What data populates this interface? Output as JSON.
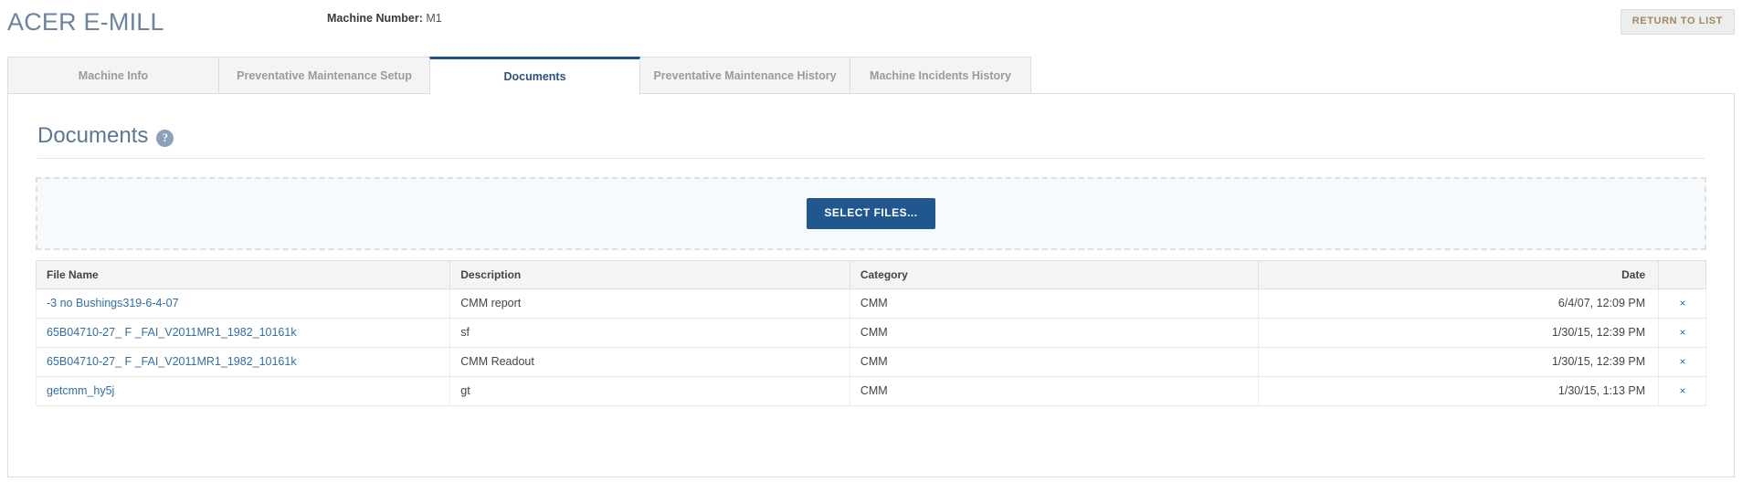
{
  "header": {
    "brand": "ACER E-MILL",
    "machine_number_label": "Machine Number:",
    "machine_number_value": "M1",
    "return_button": "RETURN TO LIST"
  },
  "tabs": [
    {
      "label": "Machine Info",
      "active": false
    },
    {
      "label": "Preventative Maintenance Setup",
      "active": false
    },
    {
      "label": "Documents",
      "active": true
    },
    {
      "label": "Preventative Maintenance History",
      "active": false
    },
    {
      "label": "Machine Incidents History",
      "active": false
    }
  ],
  "section": {
    "title": "Documents",
    "help_icon": "help-icon",
    "help_glyph": "?"
  },
  "dropzone": {
    "select_files_label": "SELECT FILES..."
  },
  "table": {
    "columns": [
      "File Name",
      "Description",
      "Category",
      "Date",
      ""
    ],
    "rows": [
      {
        "file_name": "-3 no Bushings319-6-4-07",
        "description": "CMM report",
        "category": "CMM",
        "date": "6/4/07, 12:09 PM",
        "remove": "×"
      },
      {
        "file_name": "65B04710-27_ F _FAI_V2011MR1_1982_10161k",
        "description": "sf",
        "category": "CMM",
        "date": "1/30/15, 12:39 PM",
        "remove": "×"
      },
      {
        "file_name": "65B04710-27_ F _FAI_V2011MR1_1982_10161k",
        "description": "CMM Readout",
        "category": "CMM",
        "date": "1/30/15, 12:39 PM",
        "remove": "×"
      },
      {
        "file_name": "getcmm_hy5j",
        "description": "gt",
        "category": "CMM",
        "date": "1/30/15, 1:13 PM",
        "remove": "×"
      }
    ]
  },
  "colors": {
    "brand_text": "#6d83a0",
    "active_tab_text": "#2c5282",
    "active_tab_accent": "#1f5389",
    "primary_button": "#21578f",
    "link": "#2f6fa8",
    "return_button_text": "#a18a5d"
  }
}
